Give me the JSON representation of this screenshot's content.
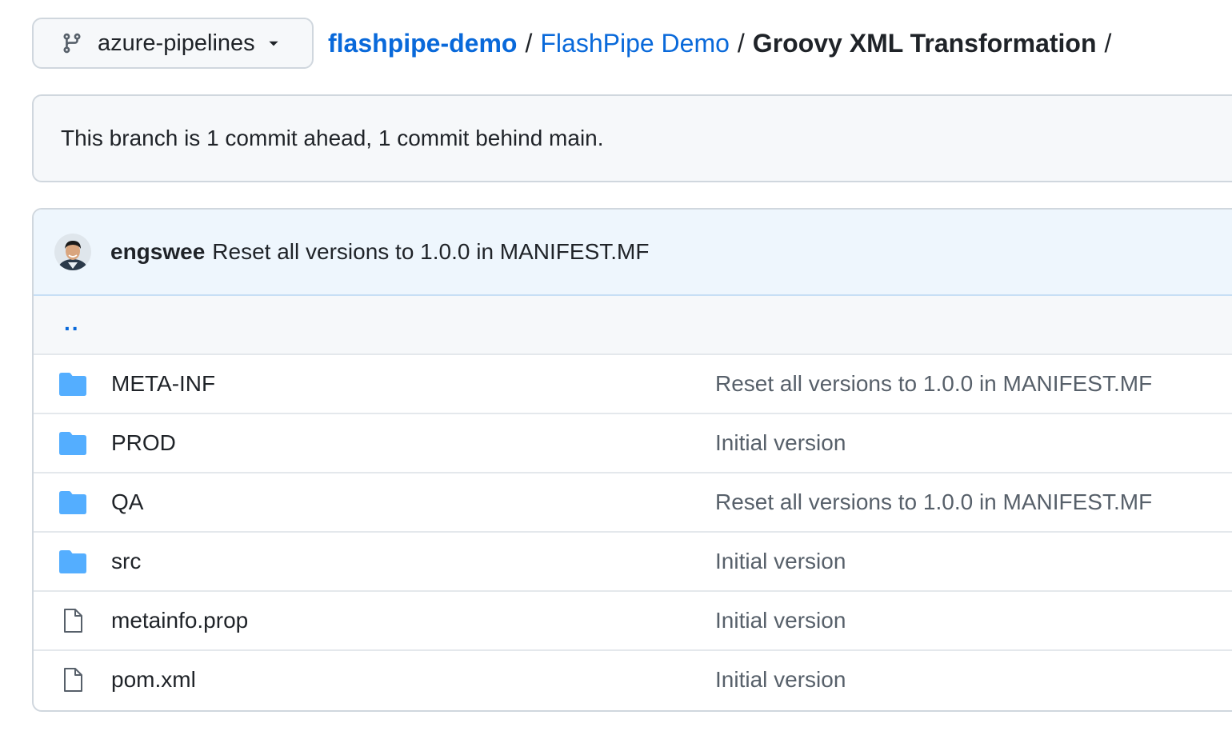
{
  "branch": {
    "name": "azure-pipelines",
    "icon": "git-branch-icon"
  },
  "breadcrumb": {
    "repo": "flashpipe-demo",
    "folder": "FlashPipe Demo",
    "current": "Groovy XML Transformation",
    "separator": "/"
  },
  "status": {
    "text": "This branch is 1 commit ahead, 1 commit behind main."
  },
  "latest_commit": {
    "author": "engswee",
    "message": "Reset all versions to 1.0.0 in MANIFEST.MF"
  },
  "parent_link": "..",
  "files": [
    {
      "name": "META-INF",
      "type": "folder",
      "message": "Reset all versions to 1.0.0 in MANIFEST.MF"
    },
    {
      "name": "PROD",
      "type": "folder",
      "message": "Initial version"
    },
    {
      "name": "QA",
      "type": "folder",
      "message": "Reset all versions to 1.0.0 in MANIFEST.MF"
    },
    {
      "name": "src",
      "type": "folder",
      "message": "Initial version"
    },
    {
      "name": "metainfo.prop",
      "type": "file",
      "message": "Initial version"
    },
    {
      "name": "pom.xml",
      "type": "file",
      "message": "Initial version"
    }
  ],
  "colors": {
    "link": "#0969da",
    "folder": "#54aeff",
    "file": "#57606a"
  }
}
